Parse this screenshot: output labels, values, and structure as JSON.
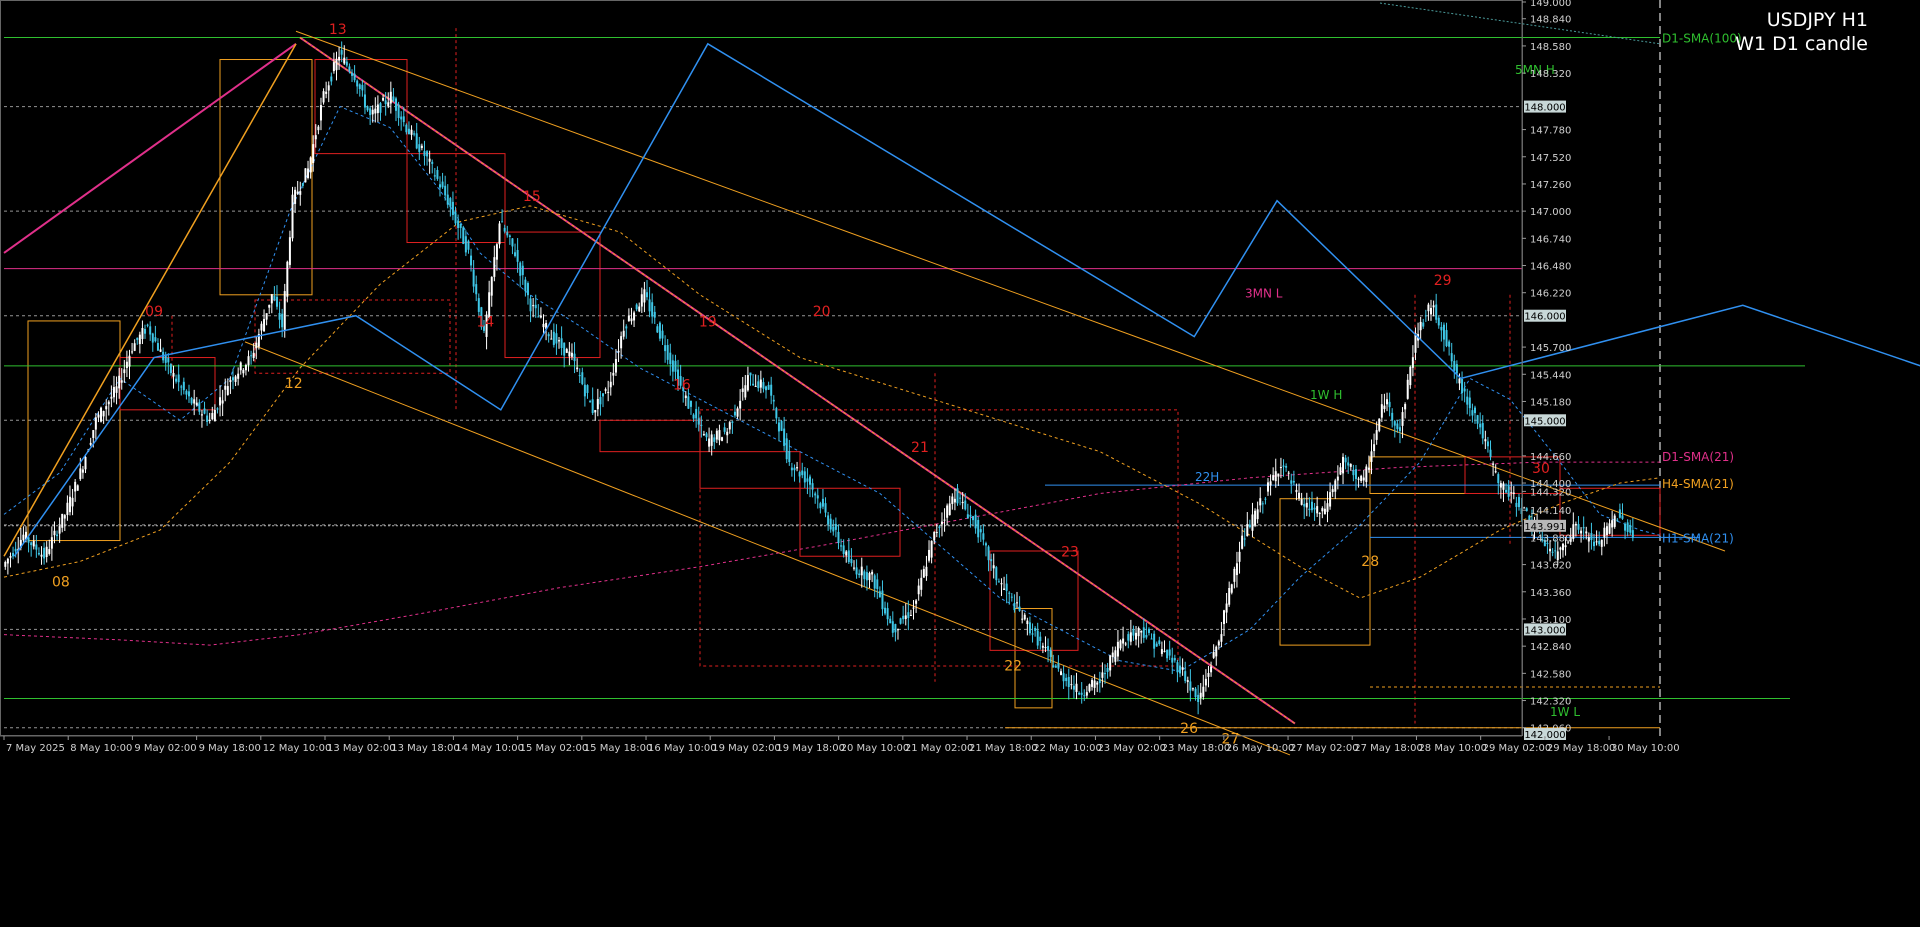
{
  "chart_data": {
    "type": "candlestick",
    "symbol_timeframe": "USDJPY H1",
    "subtitle": "W1 D1 candle",
    "colors": {
      "background": "#000000",
      "bull": "#ffffff",
      "bear": "#3fc8e8",
      "green_level": "#2fbf2f",
      "magenta": "#e0308a",
      "orange": "#f0a020",
      "red": "#e02020",
      "blue": "#3090f0",
      "axis_text": "#d0d0d0"
    },
    "ylim": [
      142.0,
      149.0
    ],
    "price_axis_labels": [
      "149.000",
      "148.840",
      "148.580",
      "148.320",
      "148.000",
      "147.780",
      "147.520",
      "147.260",
      "147.000",
      "146.740",
      "146.480",
      "146.220",
      "146.000",
      "145.700",
      "145.440",
      "145.180",
      "145.000",
      "144.320",
      "144.660",
      "144.400",
      "144.140",
      "143.991",
      "143.880",
      "143.620",
      "143.360",
      "143.100",
      "143.000",
      "142.840",
      "142.580",
      "142.320",
      "142.060",
      "142.000"
    ],
    "highlighted_price_labels": [
      "148.000",
      "146.000",
      "145.000",
      "143.991",
      "143.000",
      "142.000"
    ],
    "current_price": "143.991",
    "time_axis_labels": [
      "7 May 2025",
      "8 May 10:00",
      "9 May 02:00",
      "9 May 18:00",
      "12 May 10:00",
      "13 May 02:00",
      "13 May 18:00",
      "14 May 10:00",
      "15 May 02:00",
      "15 May 18:00",
      "16 May 10:00",
      "19 May 02:00",
      "19 May 18:00",
      "20 May 10:00",
      "21 May 02:00",
      "21 May 18:00",
      "22 May 10:00",
      "23 May 02:00",
      "23 May 18:00",
      "26 May 10:00",
      "27 May 02:00",
      "27 May 18:00",
      "28 May 10:00",
      "29 May 02:00",
      "29 May 18:00",
      "30 May 10:00"
    ],
    "level_labels": [
      {
        "text": "D1-SMA(100)",
        "color": "#2fbf2f"
      },
      {
        "text": "5MN H",
        "color": "#2fbf2f"
      },
      {
        "text": "3MN L",
        "color": "#e0308a"
      },
      {
        "text": "1W H",
        "color": "#2fbf2f"
      },
      {
        "text": "D1-SMA(21)",
        "color": "#e0308a"
      },
      {
        "text": "H4-SMA(21)",
        "color": "#f0a020"
      },
      {
        "text": "H1-SMA(21)",
        "color": "#3090f0"
      },
      {
        "text": "22H",
        "color": "#3090f0"
      },
      {
        "text": "1W L",
        "color": "#2fbf2f"
      }
    ],
    "day_labels_red": [
      "13",
      "14",
      "15",
      "16",
      "09",
      "19",
      "20",
      "21",
      "23",
      "29",
      "30"
    ],
    "day_labels_orange": [
      "08",
      "12",
      "22",
      "26",
      "27",
      "28"
    ],
    "levels": {
      "d1_sma100": 148.66,
      "mn3_low": 146.45,
      "w1_high": 145.52,
      "w1_low": 142.34,
      "level_142_06": 142.06,
      "h22": 144.38
    },
    "path_points": [
      [
        0,
        143.6
      ],
      [
        8,
        143.9
      ],
      [
        16,
        143.7
      ],
      [
        24,
        144.1
      ],
      [
        30,
        144.5
      ],
      [
        36,
        145.0
      ],
      [
        44,
        145.3
      ],
      [
        50,
        145.7
      ],
      [
        56,
        145.9
      ],
      [
        64,
        145.5
      ],
      [
        72,
        145.2
      ],
      [
        80,
        145.0
      ],
      [
        88,
        145.4
      ],
      [
        96,
        145.6
      ],
      [
        104,
        146.2
      ],
      [
        108,
        145.9
      ],
      [
        112,
        147.1
      ],
      [
        118,
        147.4
      ],
      [
        124,
        148.1
      ],
      [
        130,
        148.5
      ],
      [
        136,
        148.3
      ],
      [
        142,
        147.9
      ],
      [
        150,
        148.1
      ],
      [
        156,
        147.8
      ],
      [
        164,
        147.5
      ],
      [
        172,
        147.1
      ],
      [
        180,
        146.6
      ],
      [
        186,
        145.8
      ],
      [
        192,
        146.9
      ],
      [
        198,
        146.6
      ],
      [
        204,
        146.1
      ],
      [
        212,
        145.8
      ],
      [
        220,
        145.6
      ],
      [
        228,
        145.1
      ],
      [
        234,
        145.3
      ],
      [
        240,
        145.9
      ],
      [
        248,
        146.2
      ],
      [
        256,
        145.7
      ],
      [
        264,
        145.2
      ],
      [
        272,
        144.8
      ],
      [
        280,
        144.9
      ],
      [
        288,
        145.4
      ],
      [
        296,
        145.3
      ],
      [
        304,
        144.6
      ],
      [
        312,
        144.4
      ],
      [
        320,
        144.0
      ],
      [
        328,
        143.6
      ],
      [
        336,
        143.5
      ],
      [
        344,
        143.0
      ],
      [
        352,
        143.2
      ],
      [
        360,
        143.9
      ],
      [
        368,
        144.3
      ],
      [
        376,
        144.0
      ],
      [
        384,
        143.5
      ],
      [
        392,
        143.2
      ],
      [
        400,
        142.9
      ],
      [
        408,
        142.6
      ],
      [
        416,
        142.4
      ],
      [
        424,
        142.5
      ],
      [
        432,
        142.9
      ],
      [
        440,
        143.0
      ],
      [
        448,
        142.8
      ],
      [
        456,
        142.6
      ],
      [
        462,
        142.3
      ],
      [
        470,
        142.9
      ],
      [
        478,
        143.8
      ],
      [
        486,
        144.2
      ],
      [
        494,
        144.6
      ],
      [
        502,
        144.2
      ],
      [
        510,
        144.1
      ],
      [
        518,
        144.6
      ],
      [
        526,
        144.4
      ],
      [
        534,
        145.2
      ],
      [
        540,
        144.9
      ],
      [
        546,
        145.8
      ],
      [
        552,
        146.1
      ],
      [
        556,
        145.9
      ],
      [
        562,
        145.4
      ],
      [
        570,
        145.0
      ],
      [
        578,
        144.4
      ],
      [
        586,
        144.2
      ],
      [
        594,
        143.9
      ],
      [
        600,
        143.7
      ],
      [
        608,
        144.0
      ],
      [
        616,
        143.8
      ],
      [
        624,
        144.1
      ],
      [
        630,
        143.9
      ]
    ],
    "swing_points": [
      {
        "label": "08",
        "x": 22,
        "y": 143.6
      },
      {
        "label": "09",
        "x": 58,
        "y": 145.9
      },
      {
        "label": "12",
        "x": 112,
        "y": 145.5
      },
      {
        "label": "13",
        "x": 129,
        "y": 148.6
      },
      {
        "label": "14",
        "x": 186,
        "y": 145.8
      },
      {
        "label": "15",
        "x": 204,
        "y": 147.0
      },
      {
        "label": "16",
        "x": 262,
        "y": 145.2
      },
      {
        "label": "19",
        "x": 272,
        "y": 145.8
      },
      {
        "label": "20",
        "x": 316,
        "y": 145.9
      },
      {
        "label": "21",
        "x": 354,
        "y": 144.6
      },
      {
        "label": "22",
        "x": 390,
        "y": 142.8
      },
      {
        "label": "23",
        "x": 412,
        "y": 143.6
      },
      {
        "label": "26",
        "x": 458,
        "y": 142.2
      },
      {
        "label": "27",
        "x": 474,
        "y": 142.1
      },
      {
        "label": "28",
        "x": 528,
        "y": 143.8
      },
      {
        "label": "29",
        "x": 556,
        "y": 146.2
      },
      {
        "label": "30",
        "x": 594,
        "y": 144.4
      }
    ]
  }
}
